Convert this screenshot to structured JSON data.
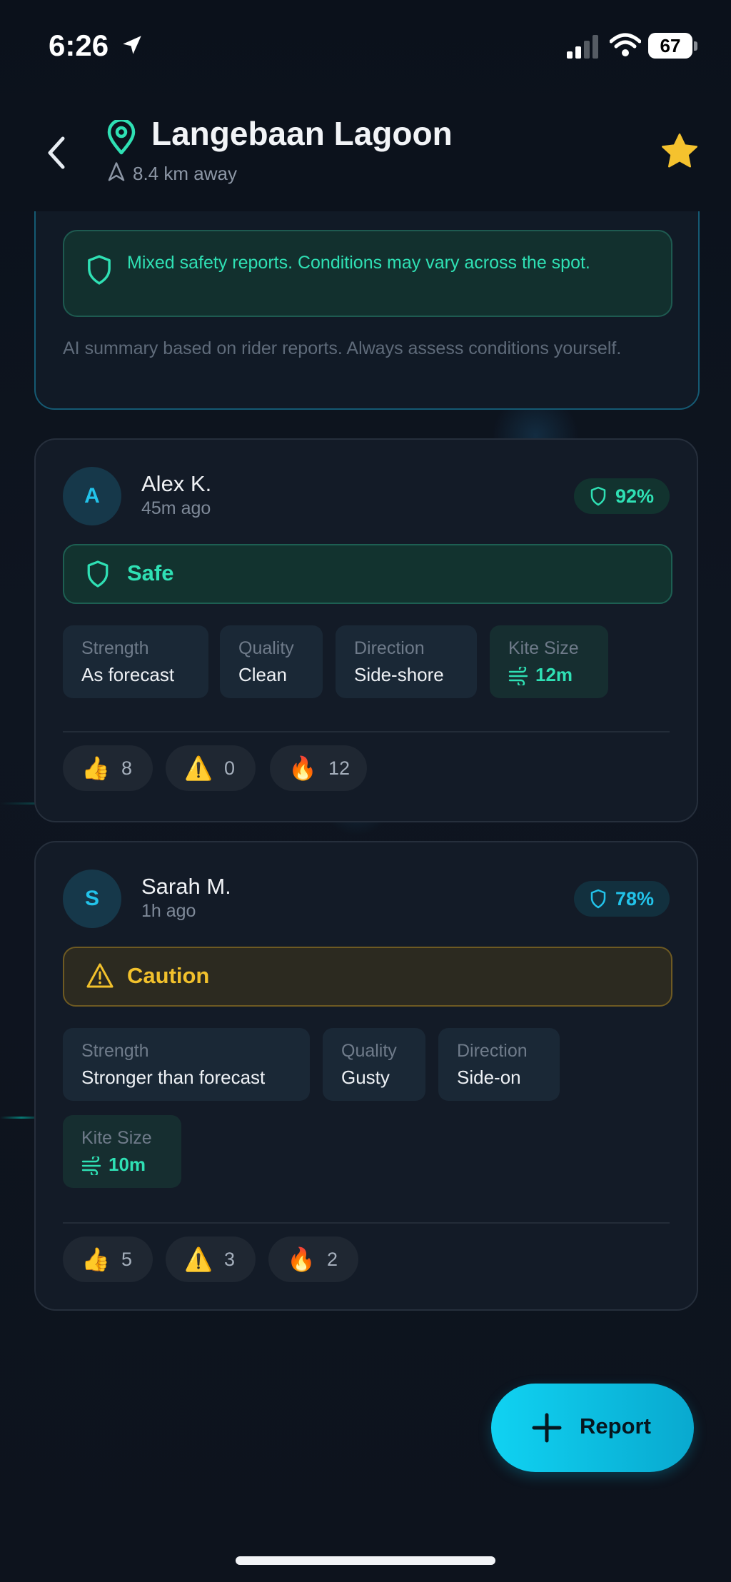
{
  "status_bar": {
    "time": "6:26",
    "battery": "67"
  },
  "header": {
    "title": "Langebaan Lagoon",
    "distance": "8.4 km away"
  },
  "summary": {
    "safety_note": "Mixed safety reports. Conditions may vary across the spot.",
    "ai_note": "AI summary based on rider reports. Always assess conditions yourself."
  },
  "reports": [
    {
      "initial": "A",
      "name": "Alex K.",
      "time_ago": "45m ago",
      "score": "92%",
      "status": "Safe",
      "strength_label": "Strength",
      "strength": "As forecast",
      "quality_label": "Quality",
      "quality": "Clean",
      "direction_label": "Direction",
      "direction": "Side-shore",
      "kite_label": "Kite Size",
      "kite": "12m",
      "reactions": {
        "thumbs": "8",
        "warning": "0",
        "fire": "12"
      }
    },
    {
      "initial": "S",
      "name": "Sarah M.",
      "time_ago": "1h ago",
      "score": "78%",
      "status": "Caution",
      "strength_label": "Strength",
      "strength": "Stronger than forecast",
      "quality_label": "Quality",
      "quality": "Gusty",
      "direction_label": "Direction",
      "direction": "Side-on",
      "kite_label": "Kite Size",
      "kite": "10m",
      "reactions": {
        "thumbs": "5",
        "warning": "3",
        "fire": "2"
      }
    }
  ],
  "fab": {
    "label": "Report"
  },
  "icons": {
    "thumbs": "👍",
    "warning": "⚠️",
    "fire": "🔥"
  },
  "colors": {
    "accent": "#22c3ea",
    "safe": "#2fe0b4",
    "caution": "#f2c12c",
    "background": "#0d141f"
  }
}
